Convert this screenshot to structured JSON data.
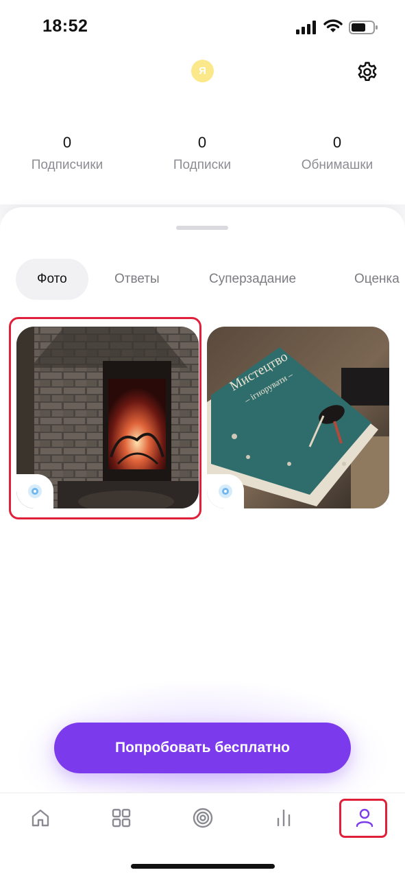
{
  "status_bar": {
    "time": "18:52"
  },
  "profile": {
    "avatar_letter": "Я"
  },
  "stats": [
    {
      "value": "0",
      "label": "Подписчики"
    },
    {
      "value": "0",
      "label": "Подписки"
    },
    {
      "value": "0",
      "label": "Обнимашки"
    }
  ],
  "tabs": [
    {
      "label": "Фото",
      "active": true
    },
    {
      "label": "Ответы",
      "active": false
    },
    {
      "label": "Суперзадание",
      "active": false
    },
    {
      "label": "Оценка",
      "active": false
    }
  ],
  "photos": [
    {
      "name": "fireplace-photo",
      "badge_icon": "eye-icon",
      "selected": true
    },
    {
      "name": "book-photo",
      "badge_icon": "eye-icon",
      "selected": false
    }
  ],
  "book_cover": {
    "title_line1": "Мистецтво",
    "title_line2": "– ігнорувати –"
  },
  "cta": {
    "label": "Попробовать бесплатно"
  },
  "bottom_nav": [
    {
      "icon": "home-icon"
    },
    {
      "icon": "grid-icon"
    },
    {
      "icon": "target-icon"
    },
    {
      "icon": "chart-icon"
    },
    {
      "icon": "profile-icon",
      "active": true
    }
  ],
  "colors": {
    "accent": "#7c3aed",
    "highlight_frame": "#e0203a",
    "avatar_bg": "#fbe88a",
    "muted_text": "#8c8c93"
  }
}
